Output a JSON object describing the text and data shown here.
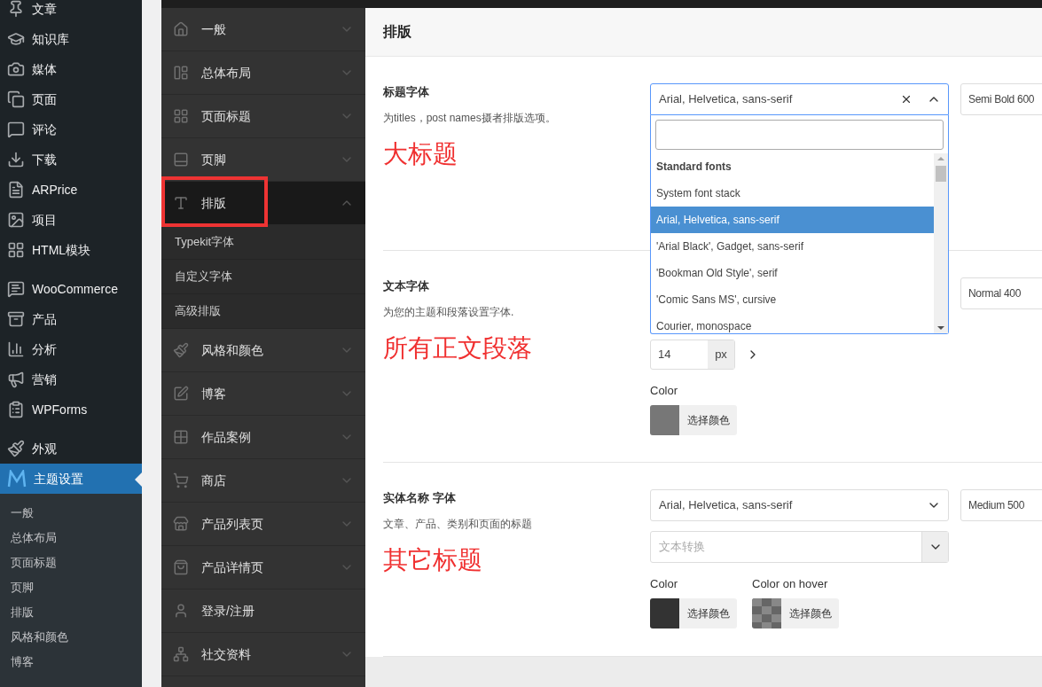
{
  "admin_menu": {
    "groups": [
      [
        {
          "label": "文章",
          "selected": false
        },
        {
          "label": "知识库",
          "selected": false
        },
        {
          "label": "媒体",
          "selected": false
        },
        {
          "label": "页面",
          "selected": false
        },
        {
          "label": "评论",
          "selected": false
        },
        {
          "label": "下载",
          "selected": false
        },
        {
          "label": "ARPrice",
          "selected": false
        },
        {
          "label": "项目",
          "selected": false
        },
        {
          "label": "HTML模块",
          "selected": false
        }
      ],
      [
        {
          "label": "WooCommerce",
          "selected": false
        },
        {
          "label": "产品",
          "selected": false
        },
        {
          "label": "分析",
          "selected": false
        },
        {
          "label": "营销",
          "selected": false
        },
        {
          "label": "WPForms",
          "selected": false
        }
      ],
      [
        {
          "label": "外观",
          "selected": false
        },
        {
          "label": "主题设置",
          "selected": true
        }
      ]
    ],
    "submenu": [
      "一般",
      "总体布局",
      "页面标题",
      "页脚",
      "排版",
      "风格和颜色",
      "博客"
    ]
  },
  "panel": {
    "items": [
      {
        "label": "一般",
        "expandable": true,
        "expanded": false
      },
      {
        "label": "总体布局",
        "expandable": true,
        "expanded": false
      },
      {
        "label": "页面标题",
        "expandable": true,
        "expanded": false
      },
      {
        "label": "页脚",
        "expandable": true,
        "expanded": false
      },
      {
        "label": "排版",
        "expandable": true,
        "expanded": true,
        "highlighted": true,
        "children": [
          "Typekit字体",
          "自定义字体",
          "高级排版"
        ]
      },
      {
        "label": "风格和颜色",
        "expandable": true,
        "expanded": false
      },
      {
        "label": "博客",
        "expandable": true,
        "expanded": false
      },
      {
        "label": "作品案例",
        "expandable": true,
        "expanded": false
      },
      {
        "label": "商店",
        "expandable": true,
        "expanded": false
      },
      {
        "label": "产品列表页",
        "expandable": true,
        "expanded": false
      },
      {
        "label": "产品详情页",
        "expandable": true,
        "expanded": false
      },
      {
        "label": "登录/注册",
        "expandable": false,
        "expanded": false
      },
      {
        "label": "社交资料",
        "expandable": true,
        "expanded": false
      }
    ]
  },
  "main": {
    "title": "排版",
    "sections": [
      {
        "label": "标题字体",
        "description": "为titles，post names摄者排版选项。",
        "annotation": "大标题",
        "font_select": {
          "value": "Arial, Helvetica, sans-serif",
          "open": true,
          "clearable": true
        },
        "weight": "Semi Bold 600",
        "dropdown": {
          "group": "Standard fonts",
          "options": [
            {
              "label": "System font stack",
              "selected": false
            },
            {
              "label": "Arial, Helvetica, sans-serif",
              "selected": true
            },
            {
              "label": "'Arial Black', Gadget, sans-serif",
              "selected": false
            },
            {
              "label": "'Bookman Old Style', serif",
              "selected": false
            },
            {
              "label": "'Comic Sans MS', cursive",
              "selected": false
            },
            {
              "label": "Courier, monospace",
              "selected": false
            }
          ]
        }
      },
      {
        "label": "文本字体",
        "description": "为您的主题和段落设置字体.",
        "annotation": "所有正文段落",
        "weight": "Normal 400",
        "size": {
          "value": "14",
          "unit": "px"
        },
        "colors": [
          {
            "label": "Color",
            "kind": "solid",
            "color": "#777777",
            "button": "选择颜色"
          }
        ]
      },
      {
        "label": "实体名称 字体",
        "description": "文章、产品、类别和页面的标题",
        "annotation": "其它标题",
        "font_select": {
          "value": "Arial, Helvetica, sans-serif",
          "open": false,
          "clearable": false
        },
        "weight": "Medium 500",
        "text_transform": {
          "placeholder": "文本转换"
        },
        "colors": [
          {
            "label": "Color",
            "kind": "solid",
            "color": "#333333",
            "button": "选择颜色"
          },
          {
            "label": "Color on hover",
            "kind": "transparent",
            "button": "选择颜色"
          }
        ]
      }
    ]
  }
}
